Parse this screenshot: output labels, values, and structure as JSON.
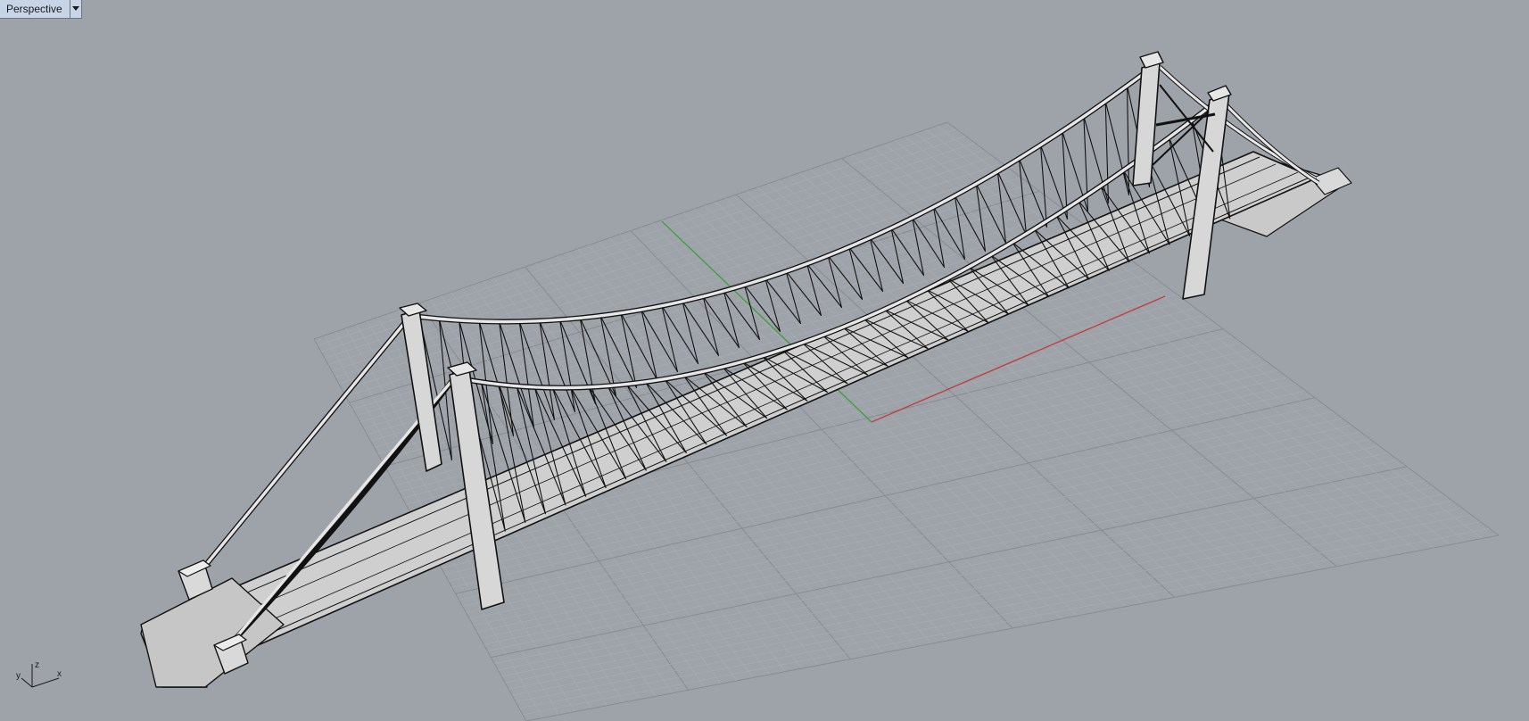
{
  "viewport": {
    "title": "Perspective",
    "menu_icon": "chevron-down-icon"
  },
  "axes": {
    "x_label": "x",
    "y_label": "y",
    "z_label": "z"
  },
  "colors": {
    "background": "#9ea3aa",
    "grid_minor": "#a8adb3",
    "grid_major": "#878c93",
    "x_axis": "#c04040",
    "y_axis": "#40a040",
    "model_fill": "#d9d9d9",
    "model_edge": "#111111"
  }
}
